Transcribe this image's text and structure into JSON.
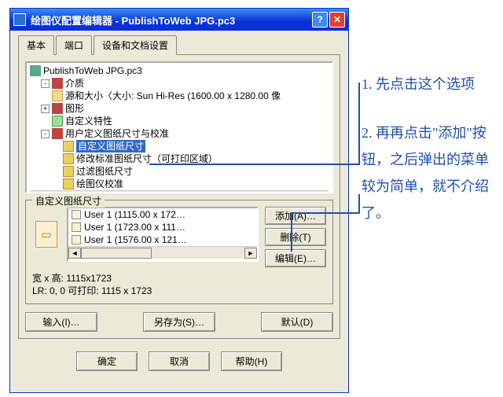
{
  "window": {
    "title": "绘图仪配置编辑器 - PublishToWeb JPG.pc3"
  },
  "tabs": {
    "items": [
      "基本",
      "端口",
      "设备和文档设置"
    ],
    "active": 2
  },
  "tree": {
    "root": "PublishToWeb JPG.pc3",
    "media": "介质",
    "size": "源和大小〈大小: Sun Hi-Res (1600.00 x 1280.00 像",
    "graphics": "图形",
    "custom_props": "自定义特性",
    "user_paper": "用户定义图纸尺寸与校准",
    "custom_size": "自定义图纸尺寸",
    "modify_std": "修改标准图纸尺寸（可打印区域）",
    "filter_sizes": "过滤图纸尺寸",
    "plotter_calib": "绘图仪校准"
  },
  "group": {
    "title": "自定义图纸尺寸",
    "list": [
      "User 1 (1115.00 x 172…",
      "User 1 (1723.00 x 111…",
      "User 1 (1576.00 x 121…"
    ],
    "buttons": {
      "add": "添加(A)…",
      "delete": "删除(T)",
      "edit": "编辑(E)…"
    },
    "info1": "宽 x 高: 1115x1723",
    "info2": "LR: 0, 0  可打印: 1115 x 1723"
  },
  "action_buttons": {
    "import": "输入(I)…",
    "saveas": "另存为(S)…",
    "default": "默认(D)"
  },
  "dialog_buttons": {
    "ok": "确定",
    "cancel": "取消",
    "help": "帮助(H)"
  },
  "annotations": {
    "a1": "1. 先点击这个选项",
    "a2": "2.  再再点击\"添加\"按钮，之后弹出的菜单较为简单，就不介绍了。"
  }
}
